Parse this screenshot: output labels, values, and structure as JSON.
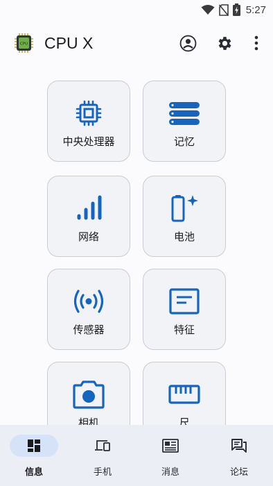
{
  "status_bar": {
    "time": "5:27",
    "icons": [
      "wifi-icon",
      "no-sim-icon",
      "battery-charging-icon"
    ]
  },
  "app_bar": {
    "title": "CPU X",
    "logo_text": "CPU",
    "actions": [
      "account-icon",
      "settings-icon",
      "more-vert-icon"
    ]
  },
  "tiles": [
    {
      "label": "中央处理器",
      "icon": "cpu-chip-icon"
    },
    {
      "label": "记忆",
      "icon": "memory-storage-icon"
    },
    {
      "label": "网络",
      "icon": "signal-bars-icon"
    },
    {
      "label": "电池",
      "icon": "battery-icon"
    },
    {
      "label": "传感器",
      "icon": "sensor-radio-icon"
    },
    {
      "label": "特征",
      "icon": "features-card-icon"
    },
    {
      "label": "相机",
      "icon": "camera-icon"
    },
    {
      "label": "尺",
      "icon": "ruler-icon"
    }
  ],
  "bottom_nav": {
    "items": [
      {
        "label": "信息",
        "icon": "dashboard-icon",
        "active": true
      },
      {
        "label": "手机",
        "icon": "devices-icon",
        "active": false
      },
      {
        "label": "消息",
        "icon": "news-icon",
        "active": false
      },
      {
        "label": "论坛",
        "icon": "forum-icon",
        "active": false
      }
    ]
  },
  "colors": {
    "accent": "#1565c0",
    "tile_bg": "#f2f3f7",
    "nav_bg": "#eceef6",
    "nav_active_pill": "#d6e2f8"
  }
}
